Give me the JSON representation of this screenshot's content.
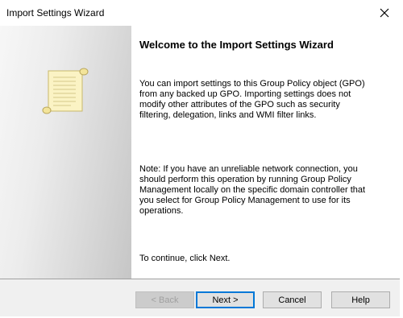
{
  "window": {
    "title": "Import Settings Wizard"
  },
  "icons": {
    "close": "close-icon",
    "illustration": "scroll-icon"
  },
  "content": {
    "heading": "Welcome to the Import Settings Wizard",
    "paragraph1": "You can import settings to this Group Policy object (GPO) from any backed up GPO. Importing settings does not modify other attributes of the GPO such as security filtering, delegation, links and WMI filter links.",
    "paragraph2": "Note: If you have an unreliable network connection, you should perform this operation by running Group Policy Management locally on the specific domain controller that you select for Group Policy Management to use for its operations.",
    "paragraph3": "To continue, click Next."
  },
  "buttons": {
    "back": "< Back",
    "next": "Next >",
    "cancel": "Cancel",
    "help": "Help"
  },
  "colors": {
    "focus_border": "#0078d7",
    "footer_bg": "#f0f0f0"
  }
}
